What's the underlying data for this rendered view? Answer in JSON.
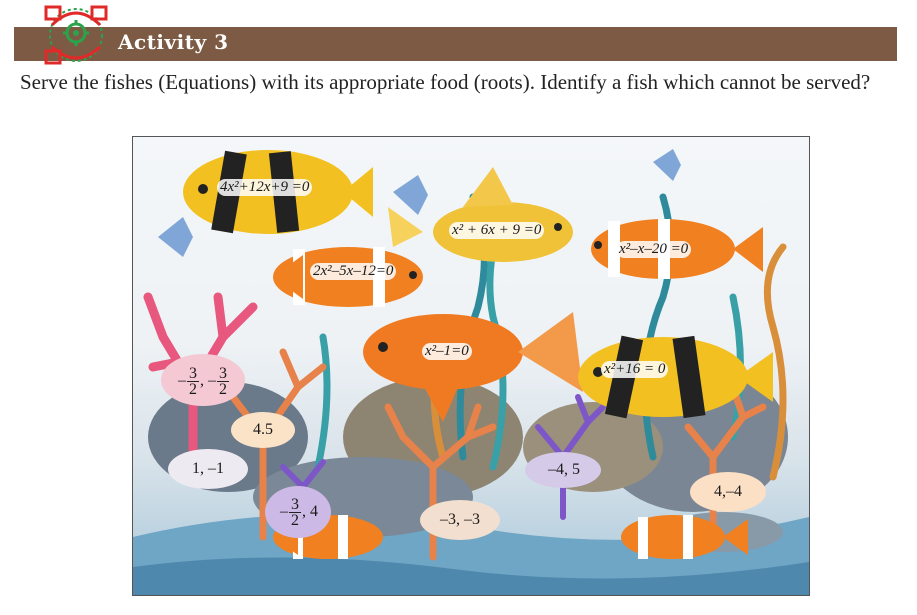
{
  "activity": {
    "title": "Activity 3"
  },
  "instruction": "Serve the fishes (Equations) with its appropriate food (roots). Identify a fish which cannot be served?",
  "equations": {
    "eq1": "4x²+12x+9 =0",
    "eq2": "x² + 6x + 9 =0",
    "eq3": "x²–x–20 =0",
    "eq4": "2x²–5x–12=0",
    "eq5": "x²–1=0",
    "eq6": "x²+16 = 0"
  },
  "roots": {
    "r1_neg": "–",
    "r1_num": "3",
    "r1_den": "2",
    "r1_sep": ", –",
    "r1_num2": "3",
    "r1_den2": "2",
    "r2": "4.5",
    "r3": "1, –1",
    "r4_num": "3",
    "r4_den": "2",
    "r4_rest": ", 4",
    "r4_neg": "–",
    "r5": "–4, 5",
    "r6": "–3, –3",
    "r7": "4,–4"
  },
  "colors": {
    "bar": "#7d5a44",
    "logo_red": "#e02a2a",
    "logo_green": "#2aa34a"
  }
}
